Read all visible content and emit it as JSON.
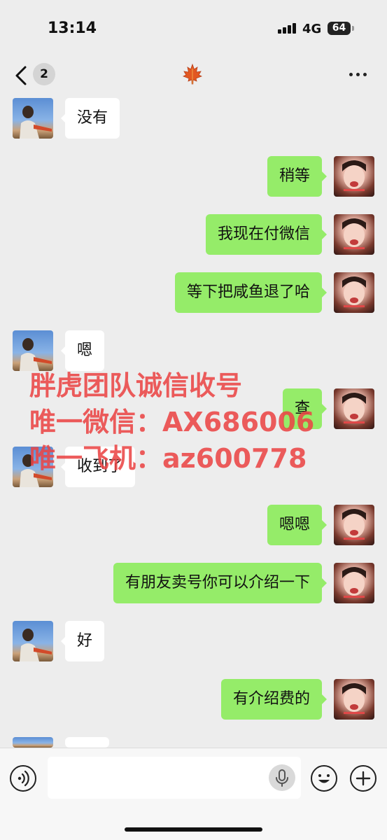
{
  "status_bar": {
    "time": "13:14",
    "network": "4G",
    "battery": "64"
  },
  "nav": {
    "unread_count": "2",
    "title_icon": "maple-leaf-icon",
    "more_icon": "more-dots-icon",
    "back_icon": "chevron-left-icon"
  },
  "messages": [
    {
      "side": "peer",
      "text": "没有"
    },
    {
      "side": "me",
      "text": "稍等"
    },
    {
      "side": "me",
      "text": "我现在付微信"
    },
    {
      "side": "me",
      "text": "等下把咸鱼退了哈"
    },
    {
      "side": "peer",
      "text": "嗯"
    },
    {
      "side": "me",
      "text": "查"
    },
    {
      "side": "peer",
      "text": "收到了"
    },
    {
      "side": "me",
      "text": "嗯嗯"
    },
    {
      "side": "me",
      "text": "有朋友卖号你可以介绍一下"
    },
    {
      "side": "peer",
      "text": "好"
    },
    {
      "side": "me",
      "text": "有介绍费的"
    },
    {
      "side": "peer",
      "text": ""
    }
  ],
  "watermark": {
    "line1": "胖虎团队诚信收号",
    "line2": "唯一微信：AX686006",
    "line3": "唯一飞机：az600778",
    "color": "#ea4646"
  },
  "input_bar": {
    "placeholder": "",
    "voice_icon": "voice-icon",
    "mic_icon": "microphone-icon",
    "emoji_icon": "emoji-icon",
    "plus_icon": "plus-icon"
  },
  "colors": {
    "background": "#ededed",
    "my_bubble": "#95ec69",
    "peer_bubble": "#ffffff"
  }
}
